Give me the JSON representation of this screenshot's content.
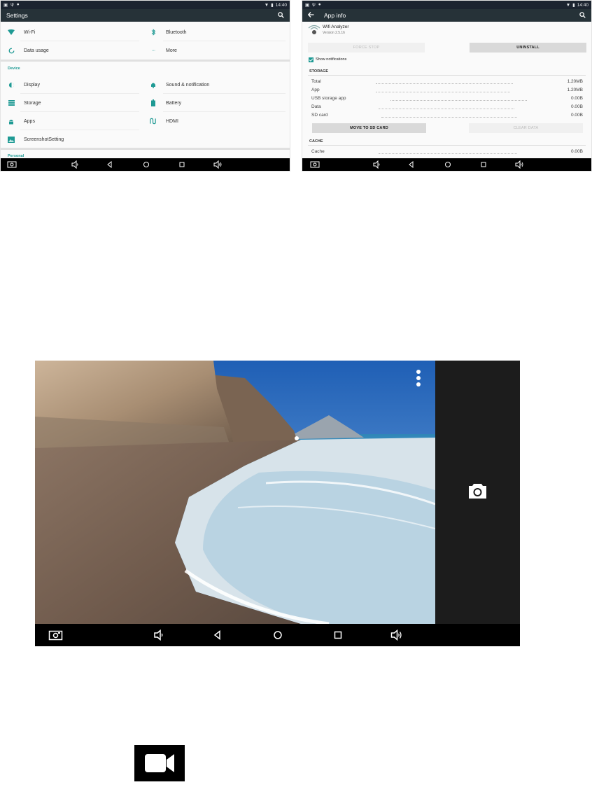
{
  "colors": {
    "accent": "#1f9a94",
    "toolbar": "#263238",
    "statusbar": "#1c2430"
  },
  "settings": {
    "status_time": "14:40",
    "title": "Settings",
    "search_icon": "search-icon",
    "row1": [
      {
        "label": "Wi-Fi",
        "icon": "wifi-icon"
      },
      {
        "label": "Bluetooth",
        "icon": "bluetooth-icon"
      }
    ],
    "row2": [
      {
        "label": "Data usage",
        "icon": "data-usage-icon"
      },
      {
        "label": "More",
        "icon": "more-icon"
      }
    ],
    "device_section": "Device",
    "device_items": [
      {
        "label": "Display",
        "icon": "display-icon"
      },
      {
        "label": "Sound & notification",
        "icon": "bell-icon"
      },
      {
        "label": "Storage",
        "icon": "storage-icon"
      },
      {
        "label": "Battery",
        "icon": "battery-icon"
      },
      {
        "label": "Apps",
        "icon": "android-icon"
      },
      {
        "label": "HDMI",
        "icon": "hdmi-icon"
      },
      {
        "label": "ScreenshotSetting",
        "icon": "screenshot-icon"
      }
    ],
    "personal_section": "Personal"
  },
  "appinfo": {
    "status_time": "14:40",
    "title": "App info",
    "app_name": "Wifi Analyzer",
    "app_version": "Version 2.5.16",
    "force_stop": "FORCE STOP",
    "uninstall": "UNINSTALL",
    "show_notifications": "Show notifications",
    "storage_section": "STORAGE",
    "storage_rows": [
      {
        "label": "Total",
        "value": "1.20MB"
      },
      {
        "label": "App",
        "value": "1.20MB"
      },
      {
        "label": "USB storage app",
        "value": "0.00B"
      },
      {
        "label": "Data",
        "value": "0.00B"
      },
      {
        "label": "SD card",
        "value": "0.00B"
      }
    ],
    "move_to_sd": "MOVE TO SD CARD",
    "clear_data": "CLEAR DATA",
    "cache_section": "CACHE",
    "cache_rows": [
      {
        "label": "Cache",
        "value": "0.00B"
      }
    ]
  },
  "camera": {
    "overflow_icon": "overflow-menu-icon",
    "shutter_icon": "camera-icon",
    "nav_icons": [
      "screenshot-icon",
      "volume-down-icon",
      "back-icon",
      "home-icon",
      "recents-icon",
      "volume-up-icon"
    ]
  },
  "video_icon": "video-camera-icon"
}
